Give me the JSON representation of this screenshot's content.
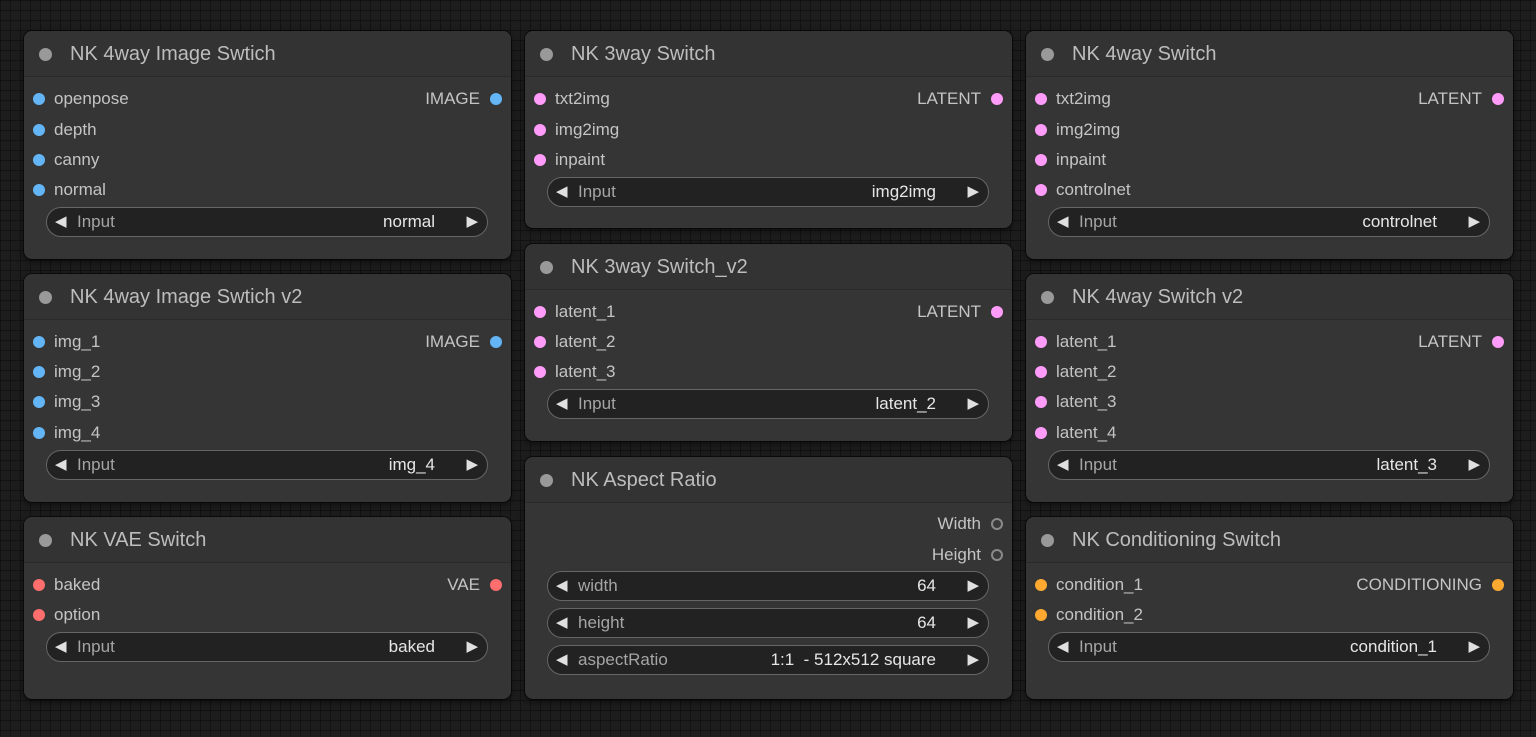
{
  "nodes": {
    "img4": {
      "title": "NK 4way Image Swtich",
      "inputs": [
        "openpose",
        "depth",
        "canny",
        "normal"
      ],
      "output": "IMAGE",
      "widget": {
        "name": "Input",
        "value": "normal"
      }
    },
    "img4v2": {
      "title": "NK 4way Image Swtich v2",
      "inputs": [
        "img_1",
        "img_2",
        "img_3",
        "img_4"
      ],
      "output": "IMAGE",
      "widget": {
        "name": "Input",
        "value": "img_4"
      }
    },
    "vae": {
      "title": "NK VAE Switch",
      "inputs": [
        "baked",
        "option"
      ],
      "output": "VAE",
      "widget": {
        "name": "Input",
        "value": "baked"
      }
    },
    "sw3": {
      "title": "NK 3way Switch",
      "inputs": [
        "txt2img",
        "img2img",
        "inpaint"
      ],
      "output": "LATENT",
      "widget": {
        "name": "Input",
        "value": "img2img"
      }
    },
    "sw3v2": {
      "title": "NK 3way Switch_v2",
      "inputs": [
        "latent_1",
        "latent_2",
        "latent_3"
      ],
      "output": "LATENT",
      "widget": {
        "name": "Input",
        "value": "latent_2"
      }
    },
    "aspect": {
      "title": "NK Aspect Ratio",
      "outputs": [
        "Width",
        "Height"
      ],
      "widgets": [
        {
          "name": "width",
          "value": "64"
        },
        {
          "name": "height",
          "value": "64"
        },
        {
          "name": "aspectRatio",
          "value": "1:1  - 512x512 square"
        }
      ]
    },
    "sw4": {
      "title": "NK 4way Switch",
      "inputs": [
        "txt2img",
        "img2img",
        "inpaint",
        "controlnet"
      ],
      "output": "LATENT",
      "widget": {
        "name": "Input",
        "value": "controlnet"
      }
    },
    "sw4v2": {
      "title": "NK 4way Switch v2",
      "inputs": [
        "latent_1",
        "latent_2",
        "latent_3",
        "latent_4"
      ],
      "output": "LATENT",
      "widget": {
        "name": "Input",
        "value": "latent_3"
      }
    },
    "cond": {
      "title": "NK Conditioning Switch",
      "inputs": [
        "condition_1",
        "condition_2"
      ],
      "output": "CONDITIONING",
      "widget": {
        "name": "Input",
        "value": "condition_1"
      }
    }
  },
  "glyphs": {
    "arrow_left": "◀",
    "arrow_right": "▶"
  },
  "colors": {
    "image": "#64b5f6",
    "latent": "#ff9cf9",
    "vae": "#ff6e6e",
    "conditioning": "#ffa931",
    "int": "#8a8a8a"
  }
}
